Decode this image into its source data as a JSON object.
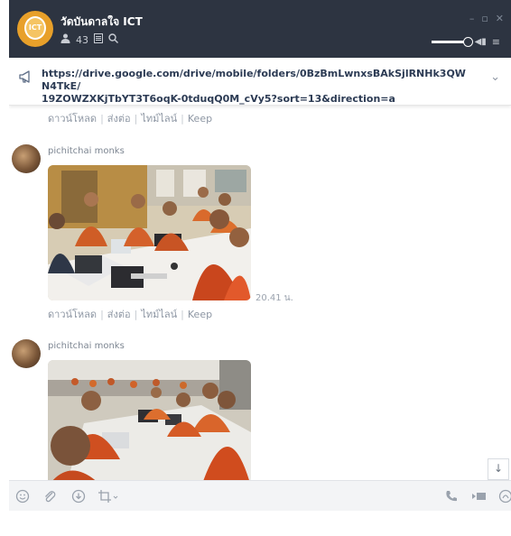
{
  "header": {
    "group_name": "วัดบันดาลใจ ICT",
    "member_count": "43",
    "avatar_text": "ICT",
    "icons": [
      "member-icon",
      "notes-icon",
      "search-icon"
    ],
    "window_controls": [
      "minimize-icon",
      "maximize-icon",
      "close-icon"
    ],
    "volume_level": 1.0
  },
  "notice": {
    "icon": "megaphone-icon",
    "url": "https://drive.google.com/drive/mobile/folders/0BzBmLwnxsBAkSjlRNHk3QWN4TkE/19ZOWZXKjTbYT3T6oqK-0tduqQ0M_cVy5?sort=13&direction=a",
    "url_line1": "https://drive.google.com/drive/mobile/folders/0BzBmLwnxsBAkSjlRNHk3QWN4TkE/",
    "url_line2": "19ZOWZXKjTbYT3T6oqK-0tduqQ0M_cVy5?sort=13&direction=a"
  },
  "messages": [
    {
      "actions": [
        "ดาวน์โหลด",
        "ส่งต่อ",
        "ไทม์ไลน์",
        "Keep"
      ]
    },
    {
      "sender": "pichitchai  monks",
      "time": "20.41 น.",
      "actions": [
        "ดาวน์โหลด",
        "ส่งต่อ",
        "ไทม์ไลน์",
        "Keep"
      ]
    },
    {
      "sender": "pichitchai  monks"
    }
  ],
  "toolbar": {
    "left_icons": [
      "emoji-icon",
      "attach-icon",
      "download-icon",
      "crop-icon"
    ],
    "right_icons": [
      "phone-icon",
      "video-icon",
      "more-icon"
    ],
    "scroll_down": "↓"
  },
  "colors": {
    "header_bg": "#2d3441",
    "robe": "#d9541e",
    "link": "#2c3b54"
  }
}
